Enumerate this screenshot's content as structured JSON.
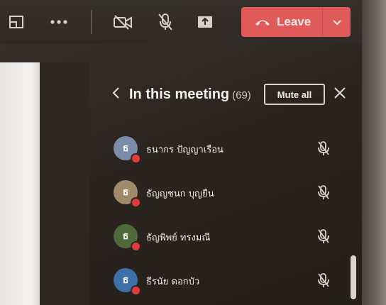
{
  "toolbar": {
    "items": [
      {
        "icon": "layout-icon"
      },
      {
        "icon": "more-options-icon"
      },
      {
        "icon": "camera-off-icon"
      },
      {
        "icon": "mic-off-icon"
      },
      {
        "icon": "share-screen-icon"
      }
    ],
    "leave": {
      "label": "Leave",
      "icon": "phone-hangup-icon",
      "caret_icon": "chevron-down-icon",
      "color": "#e05a5a"
    }
  },
  "panel": {
    "title": "In this meeting",
    "count": "(69)",
    "mute_all_label": "Mute all",
    "back_icon": "chevron-left-icon",
    "close_icon": "close-icon"
  },
  "participants": [
    {
      "name": "ธนากร ปัญญาเรือน",
      "initials": "ธ",
      "avatar_color": "#7a8ca8",
      "mic": "mic-off-icon",
      "status_color": "#e23b3b"
    },
    {
      "name": "ธัญญชนก บุญยืน",
      "initials": "ธ",
      "avatar_color": "#a08a6a",
      "mic": "mic-off-icon",
      "status_color": "#e23b3b"
    },
    {
      "name": "ธัญพิพย์ ทรงมณี",
      "initials": "ธ",
      "avatar_color": "#4e6a3a",
      "mic": "mic-off-icon",
      "status_color": "#e23b3b"
    },
    {
      "name": "ธีรนัย ดอกบัว",
      "initials": "ธ",
      "avatar_color": "#3d6fa8",
      "mic": "mic-off-icon",
      "status_color": "#e23b3b"
    }
  ]
}
